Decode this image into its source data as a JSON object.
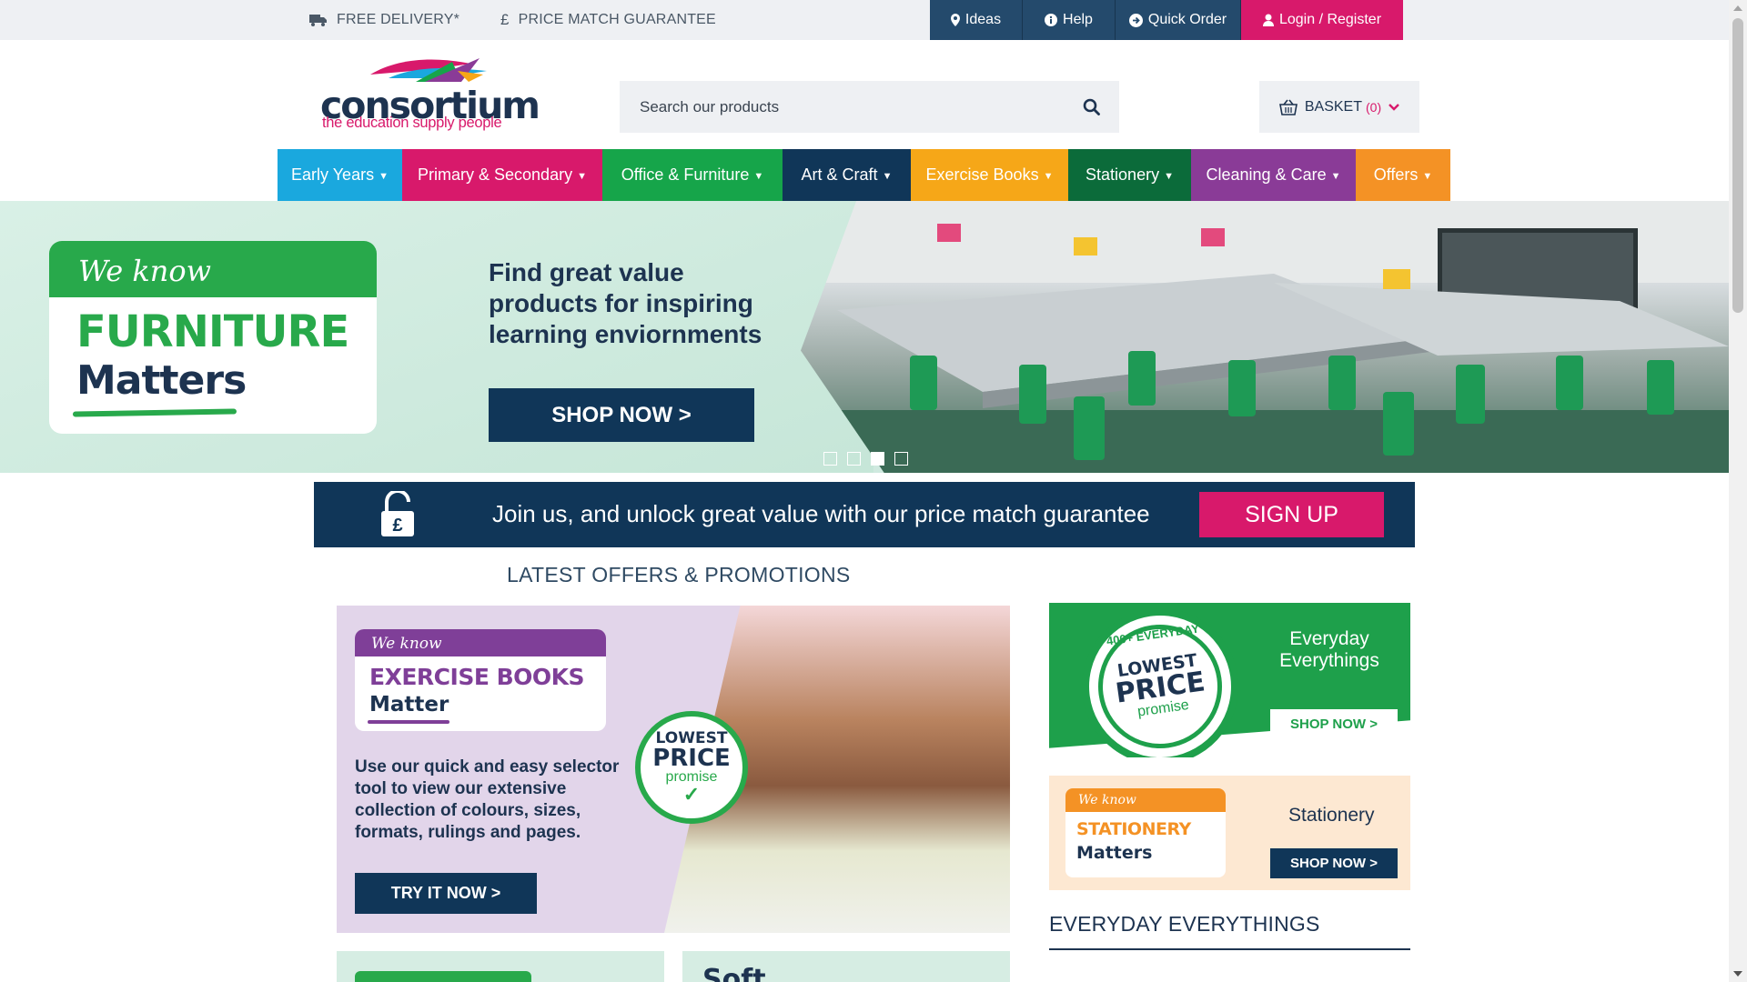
{
  "topbar": {
    "usps": [
      {
        "icon": "truck-icon",
        "label": "FREE DELIVERY*"
      },
      {
        "icon": "pound-icon",
        "label": "PRICE MATCH GUARANTEE"
      }
    ],
    "links": [
      {
        "icon": "map-pin-icon",
        "label": "Ideas"
      },
      {
        "icon": "info-icon",
        "label": "Help"
      },
      {
        "icon": "arrow-circle-icon",
        "label": "Quick Order"
      },
      {
        "icon": "user-icon",
        "label": "Login / Register"
      }
    ]
  },
  "header": {
    "logo_word": "consortium",
    "logo_tagline": "the education supply people",
    "search_placeholder": "Search our products",
    "basket_label": "BASKET",
    "basket_count": "(0)"
  },
  "nav": [
    {
      "label": "Early Years",
      "color": "#1aa8de"
    },
    {
      "label": "Primary & Secondary",
      "color": "#d8196b"
    },
    {
      "label": "Office & Furniture",
      "color": "#16a54a"
    },
    {
      "label": "Art & Craft",
      "color": "#103658"
    },
    {
      "label": "Exercise Books",
      "color": "#f6a718"
    },
    {
      "label": "Stationery",
      "color": "#0b6b3a"
    },
    {
      "label": "Cleaning & Care",
      "color": "#8a3b97"
    },
    {
      "label": "Offers",
      "color": "#f49225"
    }
  ],
  "hero": {
    "badge_script": "We know",
    "badge_word1": "FURNITURE",
    "badge_word2": "Matters",
    "headline": "Find great value products for inspiring learning enviornments",
    "cta": "SHOP NOW >",
    "slide_count": 4,
    "active_slide": 3
  },
  "signup": {
    "message": "Join us, and unlock great value with our price match guarantee",
    "button": "SIGN UP"
  },
  "latest_title": "LATEST OFFERS & PROMOTIONS",
  "promo_main": {
    "script": "We know",
    "word1": "EXERCISE BOOKS",
    "word2": "Matter",
    "body": "Use our quick and easy selector tool to view our extensive collection of colours, sizes, formats, rulings and pages.",
    "cta": "TRY IT NOW >",
    "seal_1": "LOWEST",
    "seal_2": "PRICE",
    "seal_3": "promise"
  },
  "side_everyday": {
    "seal_arc": "400+ EVERYDAY",
    "seal_1": "LOWEST",
    "seal_2": "PRICE",
    "seal_3": "promise",
    "title": "Everyday Everythings",
    "cta": "SHOP NOW >"
  },
  "side_stationery": {
    "script": "We know",
    "word1": "STATIONERY",
    "word2": "Matters",
    "title": "Stationery",
    "cta": "SHOP NOW >"
  },
  "everyday_heading": "EVERYDAY EVERYTHINGS",
  "tile2_text": "Soft"
}
